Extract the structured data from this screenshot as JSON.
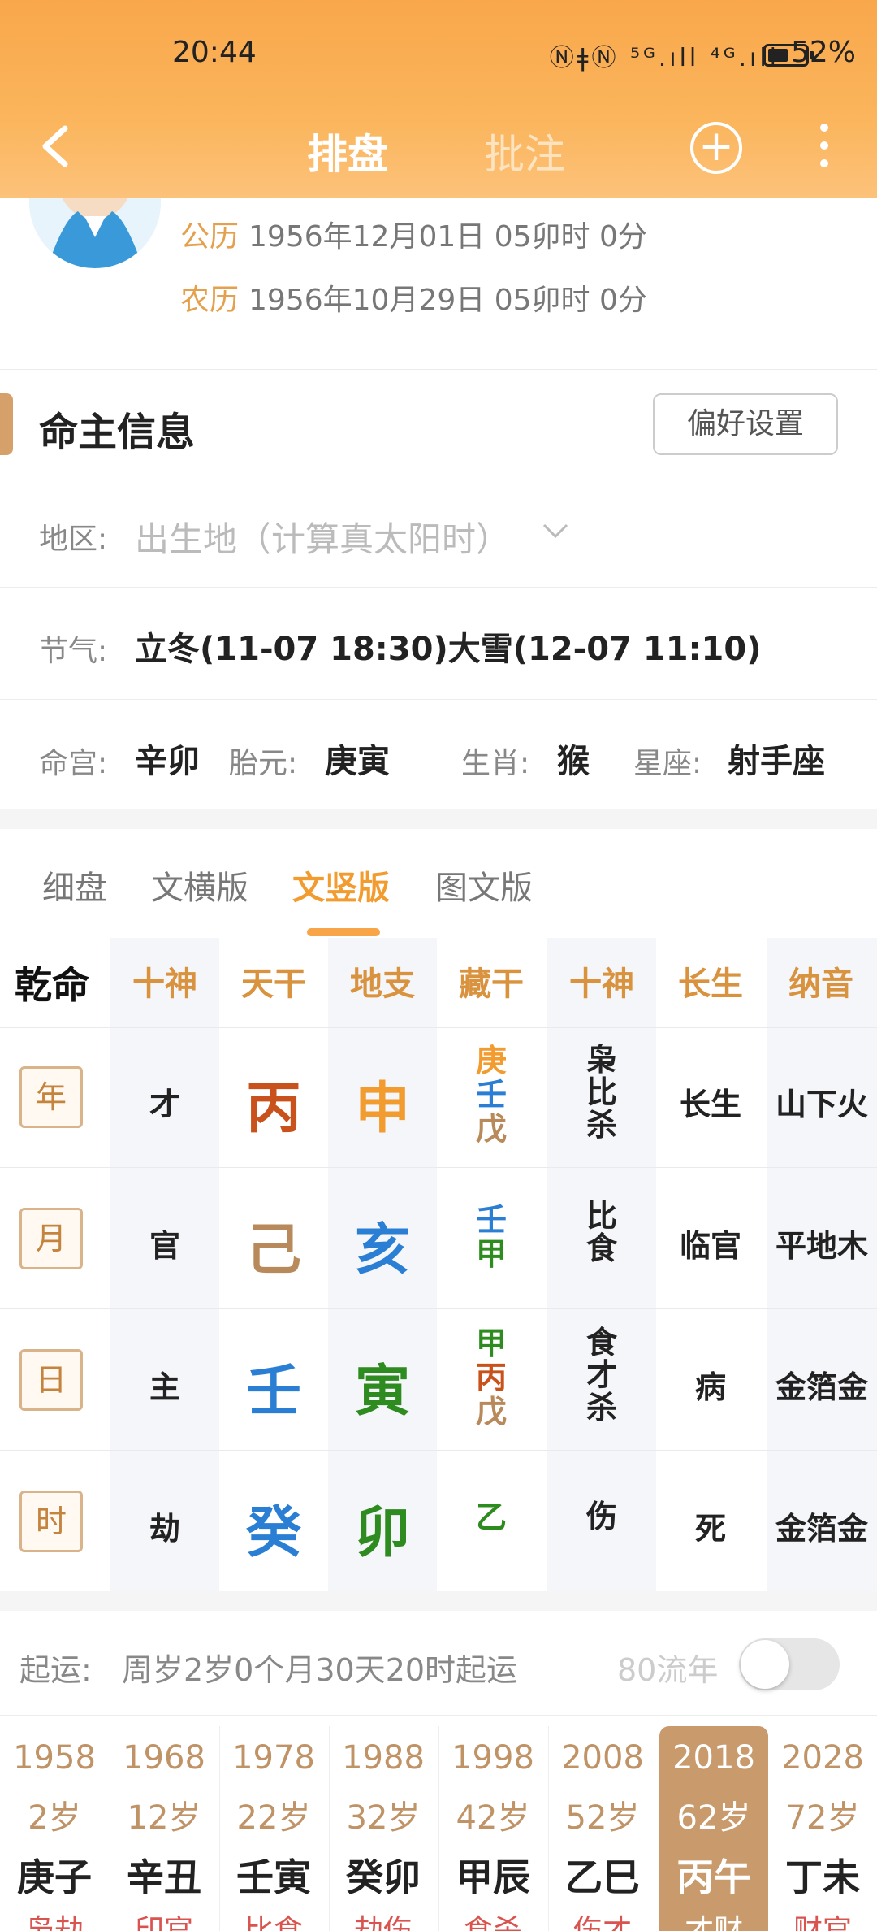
{
  "status": {
    "time": "20:44",
    "icons": "ⓃǂⓃ ⁵ᴳ.ıll ⁴ᴳ.ıll",
    "battery": "52%"
  },
  "nav": {
    "tab_active": "排盘",
    "tab_inactive": "批注"
  },
  "profile": {
    "solar_label": "公历",
    "solar_value": "1956年12月01日 05卯时 0分",
    "lunar_label": "农历",
    "lunar_value": "1956年10月29日 05卯时 0分"
  },
  "section": {
    "title": "命主信息",
    "pref_button": "偏好设置"
  },
  "region": {
    "label": "地区:",
    "placeholder": "出生地（计算真太阳时）"
  },
  "jieqi": {
    "label": "节气:",
    "value": "立冬(11-07 18:30)大雪(12-07 11:10)"
  },
  "info": {
    "minggong_label": "命宫:",
    "minggong": "辛卯",
    "taiyuan_label": "胎元:",
    "taiyuan": "庚寅",
    "shengxiao_label": "生肖:",
    "shengxiao": "猴",
    "xingzuo_label": "星座:",
    "xingzuo": "射手座"
  },
  "tabs": [
    "细盘",
    "文横版",
    "文竖版",
    "图文版"
  ],
  "grid": {
    "corner": "乾命",
    "headers": [
      "十神",
      "天干",
      "地支",
      "藏干",
      "十神",
      "长生",
      "纳音"
    ],
    "rows": [
      {
        "pillar": "年",
        "shishen": "才",
        "gan": "丙",
        "zhi": "申",
        "canggan": [
          "庚",
          "壬",
          "戊"
        ],
        "shishen2": [
          "枭",
          "比",
          "杀"
        ],
        "changsheng": "长生",
        "nayin": "山下火"
      },
      {
        "pillar": "月",
        "shishen": "官",
        "gan": "己",
        "zhi": "亥",
        "canggan": [
          "壬",
          "甲"
        ],
        "shishen2": [
          "比",
          "食"
        ],
        "changsheng": "临官",
        "nayin": "平地木"
      },
      {
        "pillar": "日",
        "shishen": "主",
        "gan": "壬",
        "zhi": "寅",
        "canggan": [
          "甲",
          "丙",
          "戊"
        ],
        "shishen2": [
          "食",
          "才",
          "杀"
        ],
        "changsheng": "病",
        "nayin": "金箔金"
      },
      {
        "pillar": "时",
        "shishen": "劫",
        "gan": "癸",
        "zhi": "卯",
        "canggan": [
          "乙"
        ],
        "shishen2": [
          "伤"
        ],
        "changsheng": "死",
        "nayin": "金箔金"
      }
    ],
    "colors": {
      "fire": "#c9521c",
      "earth": "#b8895a",
      "water": "#2a7fd4",
      "wood": "#2e8b1f",
      "metal": "#f29b2f"
    }
  },
  "qiyun": {
    "label": "起运:",
    "value": "周岁2岁0个月30天20时起运",
    "liunian": "80流年"
  },
  "dayun": [
    {
      "year": "1958",
      "age": "2岁",
      "gz": "庚子",
      "sub": "枭劫"
    },
    {
      "year": "1968",
      "age": "12岁",
      "gz": "辛丑",
      "sub": "印官"
    },
    {
      "year": "1978",
      "age": "22岁",
      "gz": "壬寅",
      "sub": "比食"
    },
    {
      "year": "1988",
      "age": "32岁",
      "gz": "癸卯",
      "sub": "劫伤"
    },
    {
      "year": "1998",
      "age": "42岁",
      "gz": "甲辰",
      "sub": "食杀"
    },
    {
      "year": "2008",
      "age": "52岁",
      "gz": "乙巳",
      "sub": "伤才"
    },
    {
      "year": "2018",
      "age": "62岁",
      "gz": "丙午",
      "sub": "才财"
    },
    {
      "year": "2028",
      "age": "72岁",
      "gz": "丁未",
      "sub": "财官"
    }
  ]
}
